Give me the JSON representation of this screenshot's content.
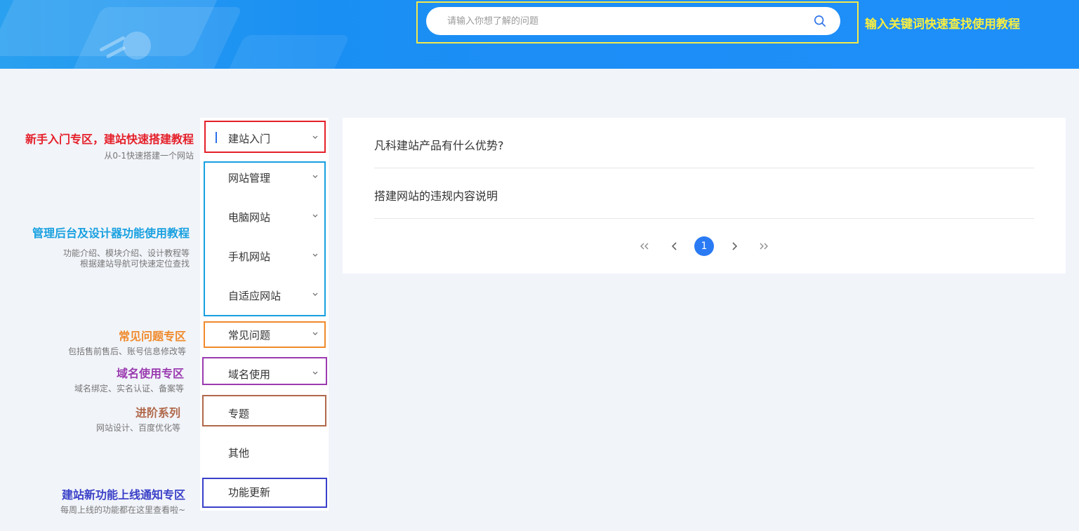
{
  "search": {
    "placeholder": "请输入你想了解的问题",
    "hint": "输入关键词快速查找使用教程"
  },
  "annotations": [
    {
      "title": "新手入门专区，建站快速搭建教程",
      "sub": [
        "从0-1快速搭建一个网站"
      ],
      "color": "#e5202a"
    },
    {
      "title": "管理后台及设计器功能使用教程",
      "sub": [
        "功能介绍、模块介绍、设计教程等",
        "根据建站导航可快速定位查找"
      ],
      "color": "#18a0e0"
    },
    {
      "title": "常见问题专区",
      "sub": [
        "包括售前售后、账号信息修改等"
      ],
      "color": "#f08a2c"
    },
    {
      "title": "域名使用专区",
      "sub": [
        "域名绑定、实名认证、备案等"
      ],
      "color": "#9b3bb0"
    },
    {
      "title": "进阶系列",
      "sub": [
        "网站设计、百度优化等"
      ],
      "color": "#b0684a"
    },
    {
      "title": "建站新功能上线通知专区",
      "sub": [
        "每周上线的功能都在这里查看啦~"
      ],
      "color": "#3a40c8"
    }
  ],
  "sidebar": {
    "items": [
      {
        "label": "建站入门",
        "has_dropdown": true,
        "active": true
      },
      {
        "label": "网站管理",
        "has_dropdown": true
      },
      {
        "label": "电脑网站",
        "has_dropdown": true
      },
      {
        "label": "手机网站",
        "has_dropdown": true
      },
      {
        "label": "自适应网站",
        "has_dropdown": true
      },
      {
        "label": "常见问题",
        "has_dropdown": true
      },
      {
        "label": "域名使用",
        "has_dropdown": true
      },
      {
        "label": "专题",
        "has_dropdown": false
      },
      {
        "label": "其他",
        "has_dropdown": false
      },
      {
        "label": "功能更新",
        "has_dropdown": false
      }
    ]
  },
  "articles": [
    {
      "title": "凡科建站产品有什么优势?"
    },
    {
      "title": "搭建网站的违规内容说明"
    }
  ],
  "pagination": {
    "current": "1"
  },
  "colors": {
    "accent": "#2a7af3",
    "hint_yellow": "#f8ef40",
    "frame_red": "#e5202a",
    "frame_blue": "#18a0e0",
    "frame_orange": "#f08a2c",
    "frame_purple": "#9b3bb0",
    "frame_brown": "#b0684a",
    "frame_indigo": "#3a40c8"
  }
}
